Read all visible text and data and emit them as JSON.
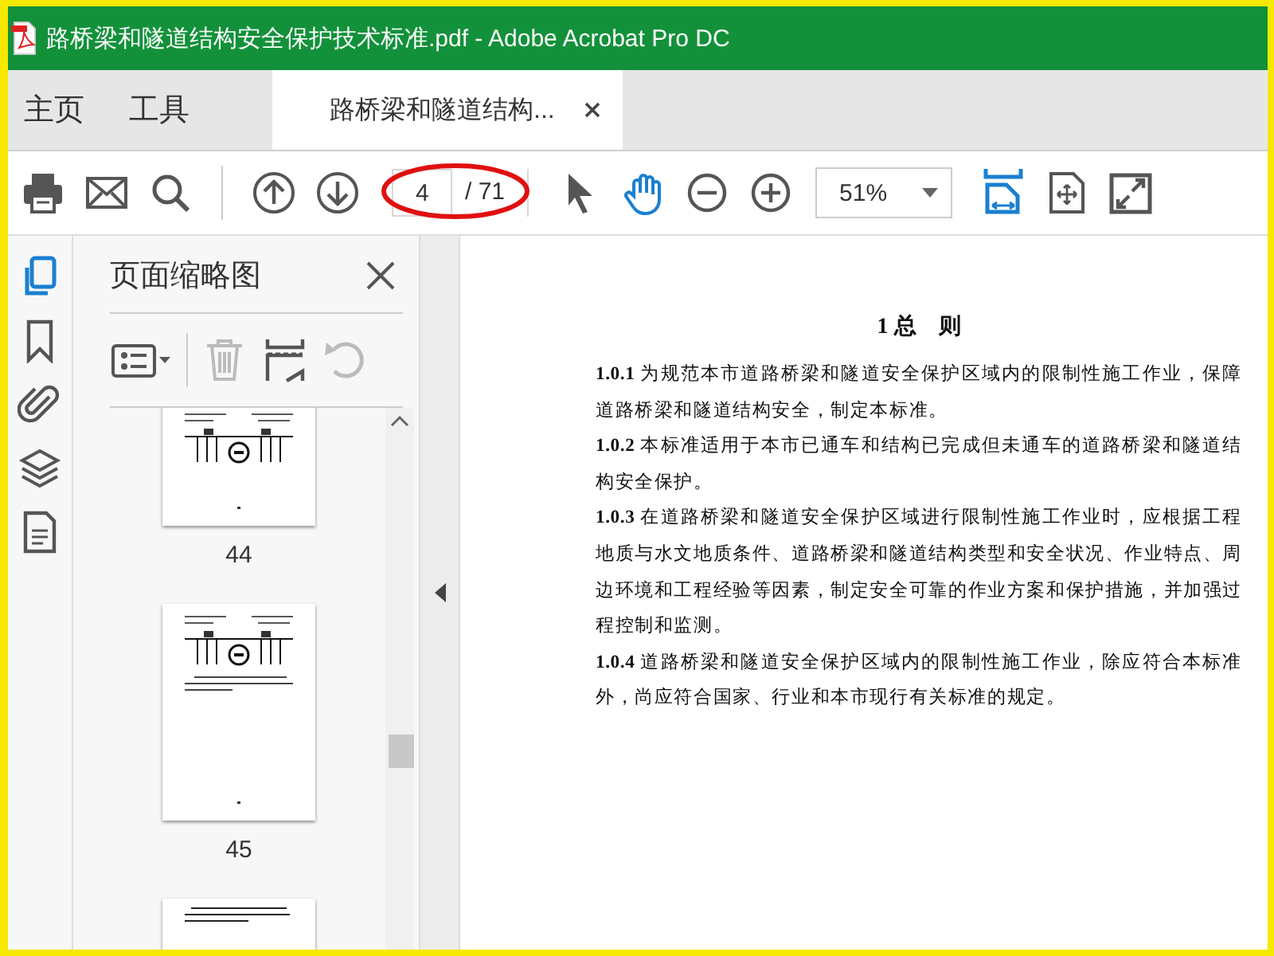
{
  "window": {
    "title": "路桥梁和隧道结构安全保护技术标准.pdf - Adobe Acrobat Pro DC"
  },
  "tabs": [
    {
      "label": "主页",
      "selected": false
    },
    {
      "label": "工具",
      "selected": false
    },
    {
      "label": "路桥梁和隧道结构...",
      "selected": true,
      "closable": true
    }
  ],
  "toolbar": {
    "page_number": "4",
    "page_count": "/ 71",
    "zoom": "51%",
    "page_number_circled": true,
    "tools": [
      {
        "kind": "select",
        "selected": false
      },
      {
        "kind": "hand",
        "selected": true
      }
    ]
  },
  "rail": [
    {
      "kind": "pages",
      "selected": true
    },
    {
      "kind": "bookmarks",
      "selected": false
    },
    {
      "kind": "attachments",
      "selected": false
    },
    {
      "kind": "layers",
      "selected": false
    },
    {
      "kind": "content",
      "selected": false
    }
  ],
  "thumbnail_panel": {
    "title": "页面缩略图",
    "thumbnails": [
      {
        "label": "44",
        "kind": "diagram"
      },
      {
        "label": "45",
        "kind": "diagram-text"
      },
      {
        "kind": "text"
      }
    ]
  },
  "document": {
    "heading": "1 总　则",
    "paragraphs": [
      "**1.0.1** 为规范本市道路桥梁和隧道安全保护区域内的限制性施工作业，保障道路桥梁和隧道结构安全，制定本标准。",
      "**1.0.2** 本标准适用于本市已通车和结构已完成但未通车的道路桥梁和隧道结构安全保护。",
      "**1.0.3** 在道路桥梁和隧道安全保护区域进行限制性施工作业时，应根据工程地质与水文地质条件、道路桥梁和隧道结构类型和安全状况、作业特点、周边环境和工程经验等因素，制定安全可靠的作业方案和保护措施，并加强过程控制和监测。",
      "**1.0.4** 道路桥梁和隧道安全保护区域内的限制性施工作业，除应符合本标准外，尚应符合国家、行业和本市现行有关标准的规定。"
    ]
  }
}
